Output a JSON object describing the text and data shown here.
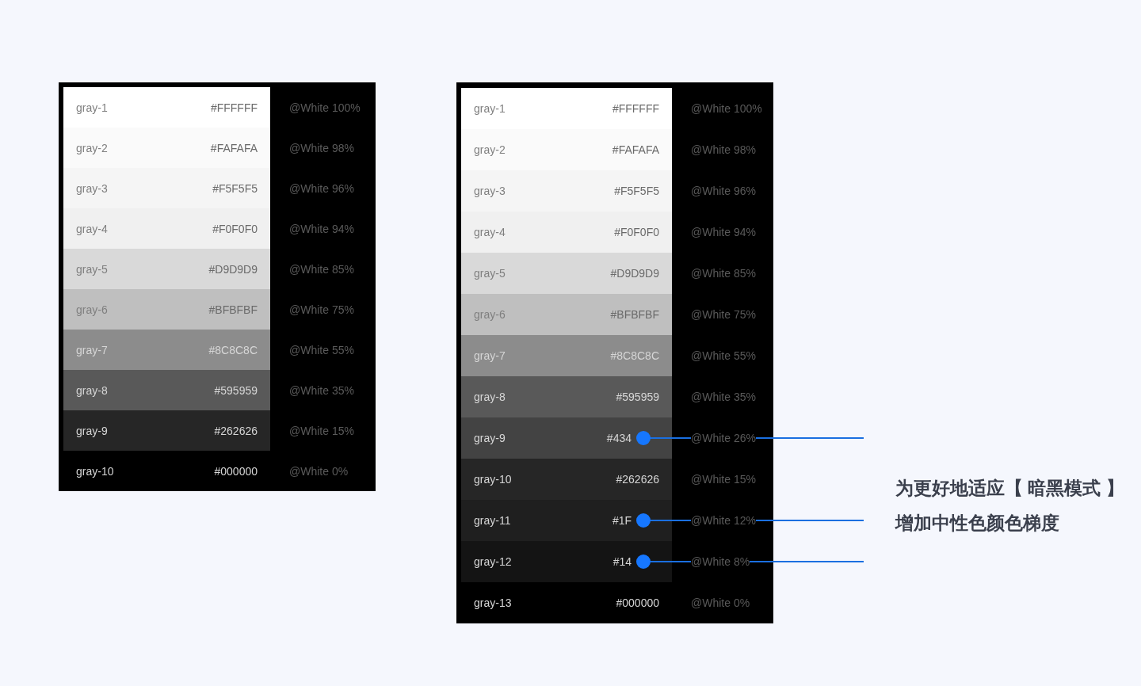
{
  "palettes": [
    {
      "rows": [
        {
          "name": "gray-1",
          "hex": "#FFFFFF",
          "color": "#ffffff",
          "alias": "@White 100%",
          "highlighted": false
        },
        {
          "name": "gray-2",
          "hex": "#FAFAFA",
          "color": "#fafafa",
          "alias": "@White 98%",
          "highlighted": false
        },
        {
          "name": "gray-3",
          "hex": "#F5F5F5",
          "color": "#f5f5f5",
          "alias": "@White 96%",
          "highlighted": false
        },
        {
          "name": "gray-4",
          "hex": "#F0F0F0",
          "color": "#f0f0f0",
          "alias": "@White 94%",
          "highlighted": false
        },
        {
          "name": "gray-5",
          "hex": "#D9D9D9",
          "color": "#d9d9d9",
          "alias": "@White 85%",
          "highlighted": false
        },
        {
          "name": "gray-6",
          "hex": "#BFBFBF",
          "color": "#bfbfbf",
          "alias": "@White 75%",
          "highlighted": false
        },
        {
          "name": "gray-7",
          "hex": "#8C8C8C",
          "color": "#8c8c8c",
          "alias": "@White 55%",
          "highlighted": false
        },
        {
          "name": "gray-8",
          "hex": "#595959",
          "color": "#595959",
          "alias": "@White 35%",
          "highlighted": false
        },
        {
          "name": "gray-9",
          "hex": "#262626",
          "color": "#262626",
          "alias": "@White 15%",
          "highlighted": false
        },
        {
          "name": "gray-10",
          "hex": "#000000",
          "color": "#000000",
          "alias": "@White 0%",
          "highlighted": false
        }
      ]
    },
    {
      "rows": [
        {
          "name": "gray-1",
          "hex": "#FFFFFF",
          "color": "#ffffff",
          "alias": "@White 100%",
          "highlighted": false
        },
        {
          "name": "gray-2",
          "hex": "#FAFAFA",
          "color": "#fafafa",
          "alias": "@White 98%",
          "highlighted": false
        },
        {
          "name": "gray-3",
          "hex": "#F5F5F5",
          "color": "#f5f5f5",
          "alias": "@White 96%",
          "highlighted": false
        },
        {
          "name": "gray-4",
          "hex": "#F0F0F0",
          "color": "#f0f0f0",
          "alias": "@White 94%",
          "highlighted": false
        },
        {
          "name": "gray-5",
          "hex": "#D9D9D9",
          "color": "#d9d9d9",
          "alias": "@White 85%",
          "highlighted": false
        },
        {
          "name": "gray-6",
          "hex": "#BFBFBF",
          "color": "#bfbfbf",
          "alias": "@White 75%",
          "highlighted": false
        },
        {
          "name": "gray-7",
          "hex": "#8C8C8C",
          "color": "#8c8c8c",
          "alias": "@White 55%",
          "highlighted": false
        },
        {
          "name": "gray-8",
          "hex": "#595959",
          "color": "#595959",
          "alias": "@White 35%",
          "highlighted": false
        },
        {
          "name": "gray-9",
          "hex": "#434",
          "color": "#434343",
          "alias": "@White 26%",
          "highlighted": true
        },
        {
          "name": "gray-10",
          "hex": "#262626",
          "color": "#262626",
          "alias": "@White 15%",
          "highlighted": false
        },
        {
          "name": "gray-11",
          "hex": "#1F",
          "color": "#1f1f1f",
          "alias": "@White 12%",
          "highlighted": true
        },
        {
          "name": "gray-12",
          "hex": "#14",
          "color": "#141414",
          "alias": "@White 8%",
          "highlighted": true
        },
        {
          "name": "gray-13",
          "hex": "#000000",
          "color": "#000000",
          "alias": "@White 0%",
          "highlighted": false
        }
      ]
    }
  ],
  "note": [
    "为更好地适应【 暗黑模式 】",
    "增加中性色颜色梯度"
  ]
}
